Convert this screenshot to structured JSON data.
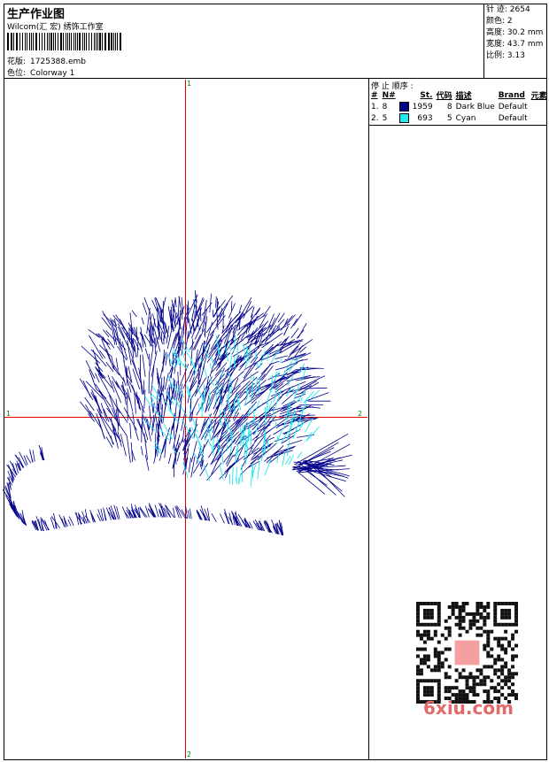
{
  "header": {
    "title": "生产作业图",
    "studio": "Wilcom(汇 宏) 绣饰工作室",
    "design_label": "花版:",
    "design_value": "1725388.emb",
    "color_label": "色位:",
    "color_value": "Colorway 1"
  },
  "stats": [
    {
      "label": "针 迹:",
      "value": "2654"
    },
    {
      "label": "颜色:",
      "value": "2"
    },
    {
      "label": "高度:",
      "value": "30.2 mm"
    },
    {
      "label": "宽度:",
      "value": "43.7 mm"
    },
    {
      "label": "比例:",
      "value": "3.13"
    }
  ],
  "stops": {
    "title": "停 止 顺序 :",
    "columns": [
      "#",
      "N#",
      "St.",
      "代码",
      "描述",
      "Brand",
      "元素"
    ],
    "rows": [
      {
        "num": "1.",
        "needle": "8",
        "color": "#00008b",
        "stitches": "1959",
        "code": "8",
        "desc": "Dark Blue",
        "brand": "Default"
      },
      {
        "num": "2.",
        "needle": "5",
        "color": "#22e8f0",
        "stitches": "693",
        "code": "5",
        "desc": "Cyan",
        "brand": "Default"
      }
    ]
  },
  "axes": {
    "top": "1",
    "left": "1",
    "right": "2",
    "bottom": "2"
  },
  "watermark": "6xiu.com",
  "colors": {
    "thread_dark_blue": "#00008b",
    "thread_cyan": "#22e8f0",
    "axis": "#e00000"
  }
}
